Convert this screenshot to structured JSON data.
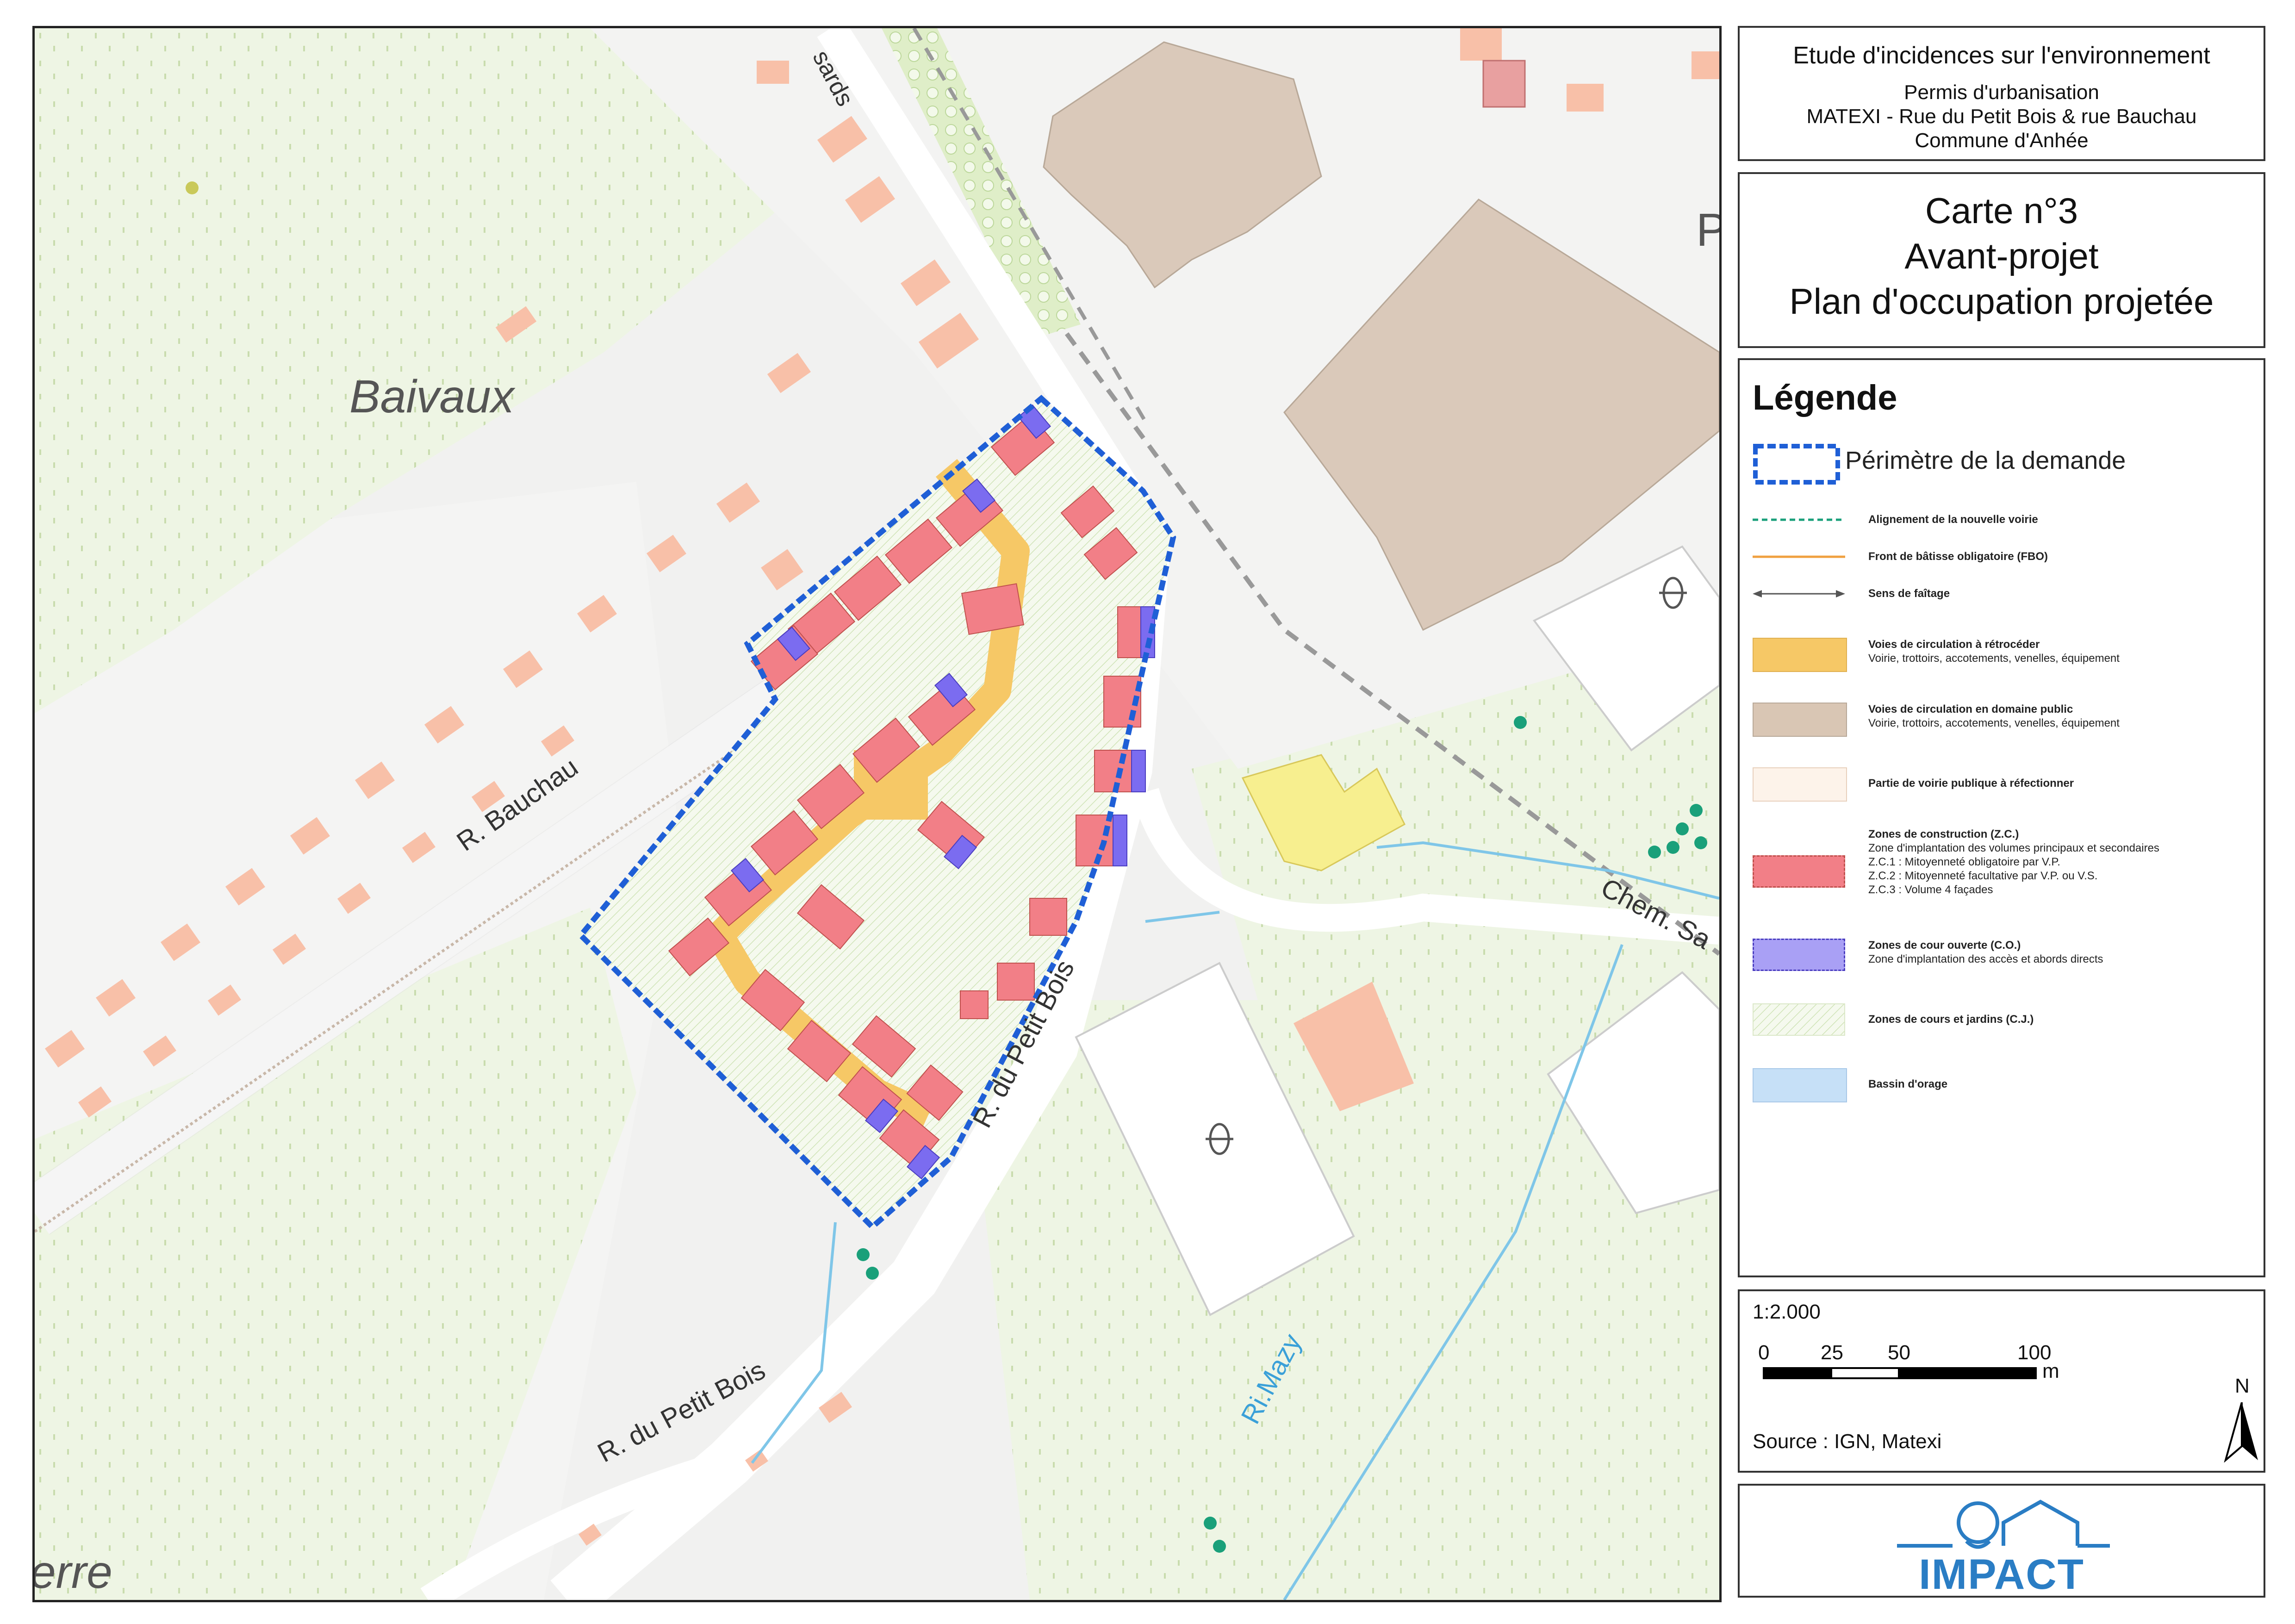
{
  "header": {
    "line1": "Etude d'incidences sur l'environnement",
    "line2": "Permis d'urbanisation",
    "line3": "MATEXI - Rue du Petit Bois & rue Bauchau",
    "line4": "Commune d'Anhée"
  },
  "title": {
    "line1": "Carte n°3",
    "line2": "Avant-projet",
    "line3": "Plan d'occupation projetée"
  },
  "legend": {
    "heading": "Légende",
    "perimetre": "Périmètre de la demande",
    "alignement": "Alignement de la nouvelle voirie",
    "fbo": "Front de bâtisse obligatoire (FBO)",
    "faitage": "Sens de faîtage",
    "retroceder": "Voies de circulation à rétrocéder",
    "retroceder_sub": "Voirie, trottoirs, accotements, venelles, équipement",
    "domaine_public": "Voies de circulation en domaine public",
    "domaine_public_sub": "Voirie, trottoirs, accotements, venelles, équipement",
    "refection": "Partie de voirie publique à réfectionner",
    "zc": "Zones de construction (Z.C.)",
    "zc_sub1": "Zone d'implantation des volumes principaux et secondaires",
    "zc_sub2": "Z.C.1 : Mitoyenneté obligatoire par V.P.",
    "zc_sub3": "Z.C.2 : Mitoyenneté facultative par V.P. ou V.S.",
    "zc_sub4": "Z.C.3 : Volume 4 façades",
    "co": "Zones de cour ouverte (C.O.)",
    "co_sub": "Zone d'implantation des accès et abords directs",
    "cj": "Zones de cours et jardins (C.J.)",
    "bassin": "Bassin d'orage"
  },
  "scale": {
    "ratio": "1:2.000",
    "t0": "0",
    "t25": "25",
    "t50": "50",
    "t100": "100",
    "unit": "m",
    "north": "N"
  },
  "source": "Source : IGN, Matexi",
  "logo": {
    "text": "IMPACT"
  },
  "map_labels": {
    "baivaux": "Baivaux",
    "bauchau": "R. Bauchau",
    "petit_bois_1": "R. du Petit Bois",
    "petit_bois_2": "R. du Petit Bois",
    "mazy": "Ri.Mazy",
    "chem": "Chem. Sa",
    "sards": "sards",
    "erre": "erre",
    "p": "P"
  },
  "colors": {
    "perimeter": "#1f5fd6",
    "zc": "#f27f87",
    "co": "#7b6cf0",
    "retroceder": "#f6c866",
    "domaine_public": "#d9c6b4",
    "building": "#f8c0a8",
    "field": "#e9f2dc",
    "water": "#7fc6e8",
    "logo": "#2a7dc4"
  }
}
